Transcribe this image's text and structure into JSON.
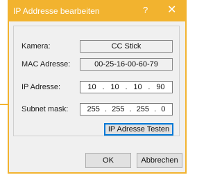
{
  "window": {
    "title": "IP Addresse bearbeiten",
    "help_glyph": "?",
    "close_glyph": "✕"
  },
  "form": {
    "kamera": {
      "label": "Kamera:",
      "value": "CC Stick"
    },
    "mac": {
      "label": "MAC Adresse:",
      "value": "00-25-16-00-60-79"
    },
    "ip": {
      "label": "IP Adresse:",
      "octets": [
        "10",
        "10",
        "10",
        "90"
      ],
      "separator": "."
    },
    "subnet": {
      "label": "Subnet mask:",
      "octets": [
        "255",
        "255",
        "255",
        "0"
      ],
      "separator": "."
    }
  },
  "buttons": {
    "test": "IP Adresse Testen",
    "ok": "OK",
    "cancel": "Abbrechen"
  },
  "colors": {
    "accent": "#f2b32f",
    "focus": "#0078d7",
    "dialog_bg": "#f0f0f0"
  }
}
